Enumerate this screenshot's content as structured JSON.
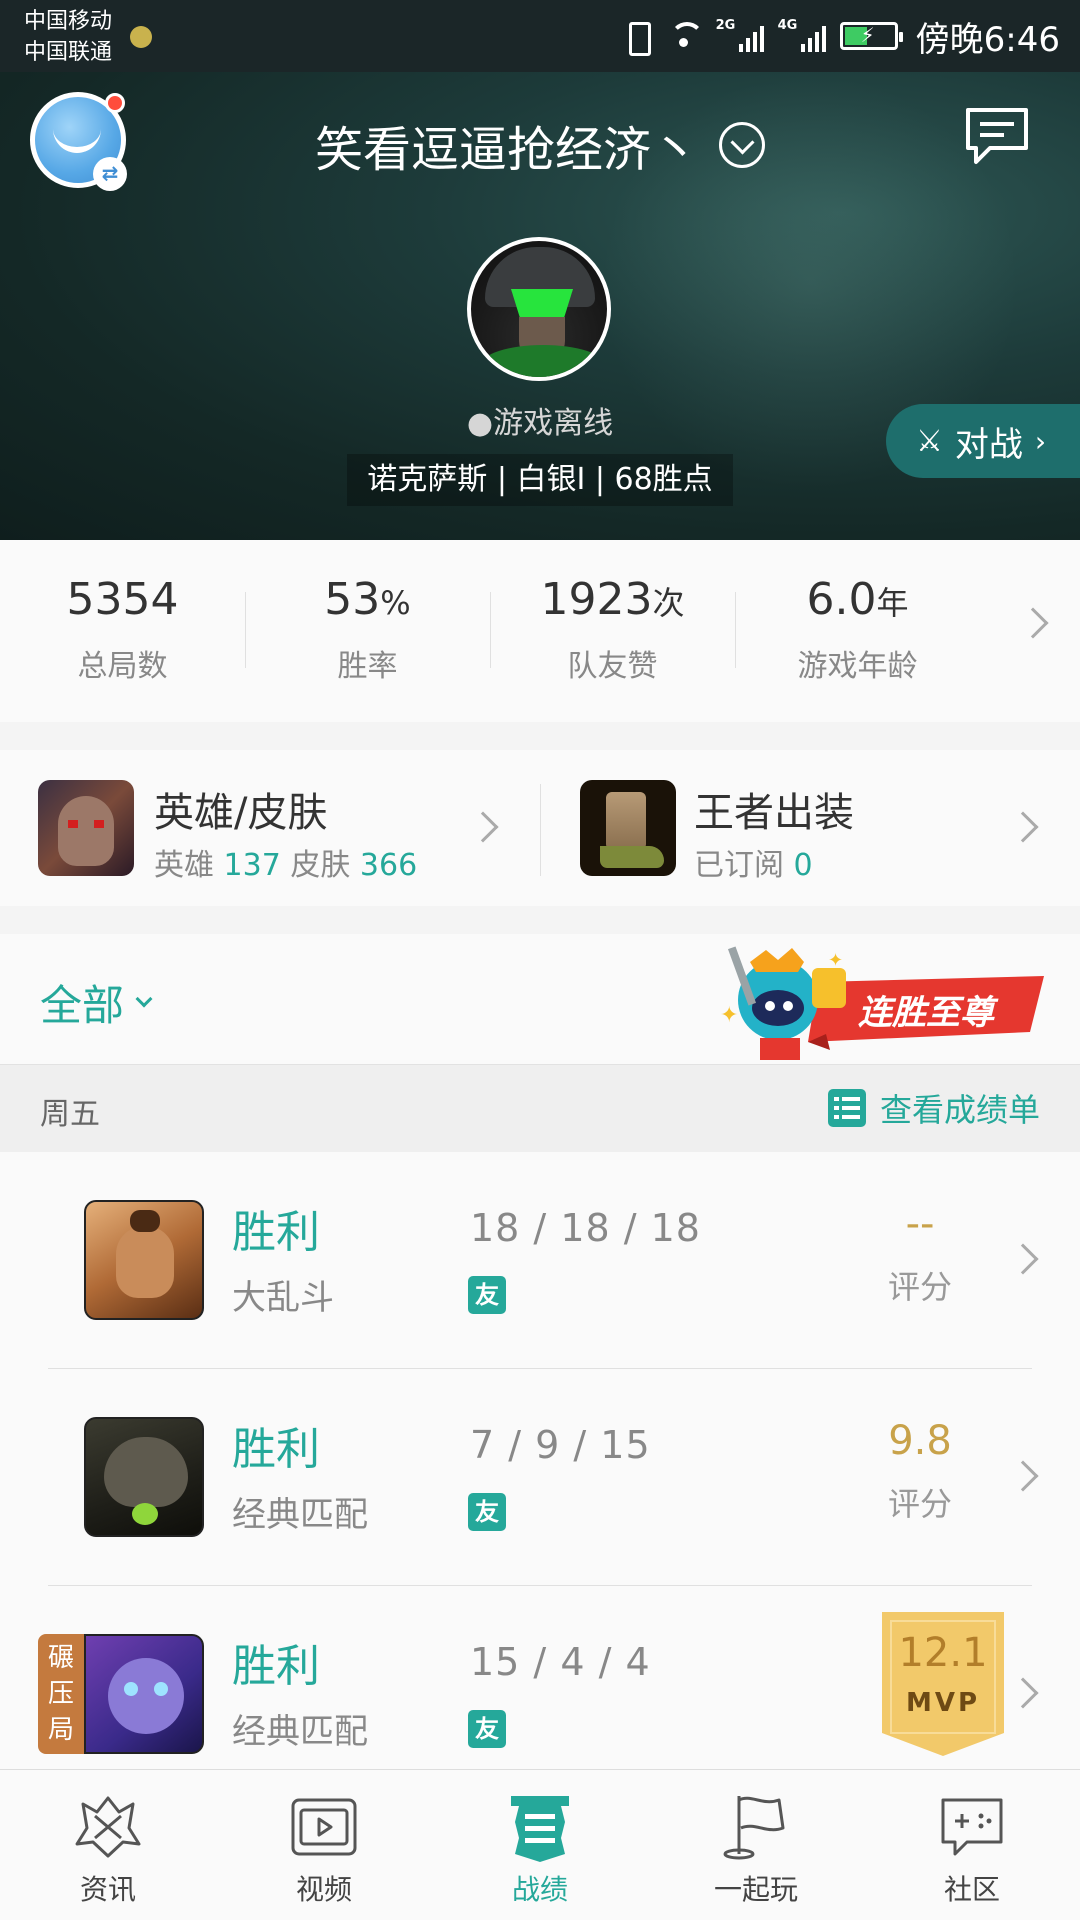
{
  "status_bar": {
    "carrier_1": "中国移动",
    "carrier_2": "中国联通",
    "net_1": "2G",
    "net_2": "4G",
    "time": "傍晚6:46"
  },
  "header": {
    "username": "笑看逗逼抢经济丶",
    "online_status": "●游戏离线",
    "rank_line": "诺克萨斯 | 白银I | 68胜点",
    "fight_button": "对战",
    "icons": {
      "avatar_badge": "swap-icon",
      "dropdown": "chevron-down-circle-icon",
      "message": "message-icon"
    }
  },
  "stats": [
    {
      "value": "5354",
      "unit": "",
      "label": "总局数"
    },
    {
      "value": "53",
      "unit": "%",
      "label": "胜率"
    },
    {
      "value": "1923",
      "unit": "次",
      "label": "队友赞"
    },
    {
      "value": "6.0",
      "unit": "年",
      "label": "游戏年龄"
    }
  ],
  "cards": {
    "heroes": {
      "title": "英雄/皮肤",
      "hero_label": "英雄",
      "hero_count": "137",
      "skin_label": "皮肤",
      "skin_count": "366"
    },
    "equipment": {
      "title": "王者出装",
      "sub_label": "已订阅",
      "sub_count": "0"
    }
  },
  "filter": {
    "label": "全部",
    "badge_text": "连胜至尊"
  },
  "day_header": {
    "day": "周五",
    "report_link": "查看成绩单"
  },
  "matches": [
    {
      "result": "胜利",
      "mode": "大乱斗",
      "kda": "18 / 18 / 18",
      "friend_tag": "友",
      "score": "--",
      "score_label": "评分",
      "mvp": false,
      "crush": ""
    },
    {
      "result": "胜利",
      "mode": "经典匹配",
      "kda": "7 / 9 / 15",
      "friend_tag": "友",
      "score": "9.8",
      "score_label": "评分",
      "mvp": false,
      "crush": ""
    },
    {
      "result": "胜利",
      "mode": "经典匹配",
      "kda": "15 / 4 / 4",
      "friend_tag": "友",
      "score": "12.1",
      "mvp_label": "MVP",
      "mvp": true,
      "crush": "碾压局"
    }
  ],
  "nav": [
    {
      "label": "资讯",
      "icon": "news-icon",
      "active": false
    },
    {
      "label": "视频",
      "icon": "video-icon",
      "active": false
    },
    {
      "label": "战绩",
      "icon": "record-icon",
      "active": true
    },
    {
      "label": "一起玩",
      "icon": "flag-icon",
      "active": false
    },
    {
      "label": "社区",
      "icon": "community-icon",
      "active": false
    }
  ],
  "colors": {
    "accent": "#25a89a",
    "score_gold": "#c8a24a",
    "header_bg": "#1d3b3a",
    "status_bar_bg": "#1b2628"
  }
}
